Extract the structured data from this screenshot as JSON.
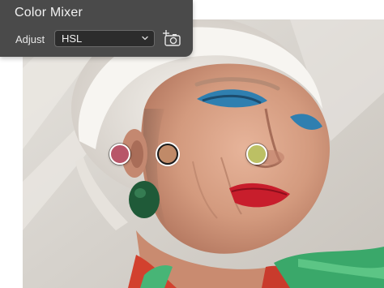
{
  "panel": {
    "title": "Color Mixer",
    "adjust_label": "Adjust",
    "adjust_value": "HSL"
  },
  "samples": [
    {
      "label": "red sample",
      "color": "#b85669"
    },
    {
      "label": "orange sample",
      "color": "#c08a68"
    },
    {
      "label": "yellow-green sample",
      "color": "#bcc064"
    }
  ],
  "colors": {
    "panel_bg": "#4a4a4a",
    "select_bg": "#2c2c2c"
  },
  "icons": {
    "dropdown": "chevron-down-icon",
    "target_tool": "targeted-adjustment-icon"
  }
}
